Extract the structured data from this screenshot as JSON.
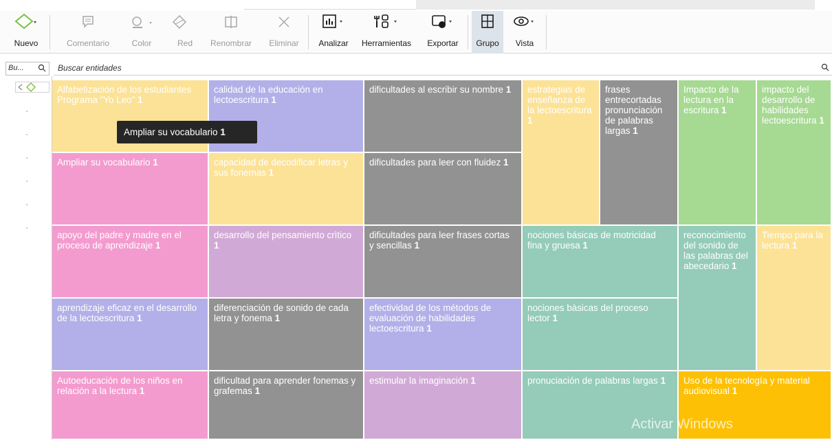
{
  "toolbar": {
    "nuevo": "Nuevo",
    "comentario": "Comentario",
    "color": "Color",
    "red": "Red",
    "renombrar": "Renombrar",
    "eliminar": "Eliminar",
    "analizar": "Analizar",
    "herramientas": "Herramientas",
    "exportar": "Exportar",
    "grupo": "Grupo",
    "vista": "Vista"
  },
  "search": {
    "small_placeholder": "Bu...",
    "main_placeholder": "Buscar entidades"
  },
  "tiles": [
    {
      "label": "Alfabetización de los estudiantes Programa \"Yo Leo\"",
      "count": "1"
    },
    {
      "label": "calidad de la educación en lectoescritura",
      "count": "1"
    },
    {
      "label": "dificultades al escribir su nombre",
      "count": "1"
    },
    {
      "label": "estrategias de enseñanza de la lectoescritura",
      "count": "1"
    },
    {
      "label": "frases entrecortadas pronunciación de palabras largas",
      "count": "1"
    },
    {
      "label": "Impacto de la lectura en la escritura",
      "count": "1"
    },
    {
      "label": "impacto del desarrollo de habilidades lectoescritura",
      "count": "1"
    },
    {
      "label": "Ampliar su vocabulario",
      "count": "1"
    },
    {
      "label": "capacidad de decodificar letras y sus fonemas",
      "count": "1"
    },
    {
      "label": "dificultades para leer con fluidez",
      "count": "1"
    },
    {
      "label": "apoyo del padre y madre en el proceso de aprendizaje",
      "count": "1"
    },
    {
      "label": "desarrollo del pensamiento crìtico",
      "count": "1"
    },
    {
      "label": "dificultades para leer frases cortas y sencillas",
      "count": "1"
    },
    {
      "label": "nociones básicas de motricidad fina y gruesa",
      "count": "1"
    },
    {
      "label": "reconocimiento del sonido de las palabras del abecedario",
      "count": "1"
    },
    {
      "label": "Tiempo para la lectura",
      "count": "1"
    },
    {
      "label": "aprendizaje eficaz en el desarrollo de la lectoescritura",
      "count": "1"
    },
    {
      "label": "diferenciación de sonido de cada letra y fonema",
      "count": "1"
    },
    {
      "label": "efectividad de los métodos de evaluación de habilidades lectoescritura",
      "count": "1"
    },
    {
      "label": "nociones bàsicas del proceso lector",
      "count": "1"
    },
    {
      "label": "Autoeducación de los niños en relación a la lectura",
      "count": "1"
    },
    {
      "label": "dificultad para aprender fonemas y grafemas",
      "count": "1"
    },
    {
      "label": "estimular la imaginación",
      "count": "1"
    },
    {
      "label": "pronuciación de palabras largas",
      "count": "1"
    },
    {
      "label": "Uso de la tecnología y material audiovisual",
      "count": "1"
    }
  ],
  "tooltip": {
    "label": "Ampliar su vocabulario",
    "count": "1"
  },
  "watermark": "Activar Windows",
  "colors": {
    "yellow": "#fce296",
    "lavender": "#b3afe8",
    "grey": "#929292",
    "pink": "#f39bcf",
    "mauve": "#d1a9d6",
    "teal": "#94cbb9",
    "green": "#a6d992",
    "orange": "#fdc004"
  }
}
